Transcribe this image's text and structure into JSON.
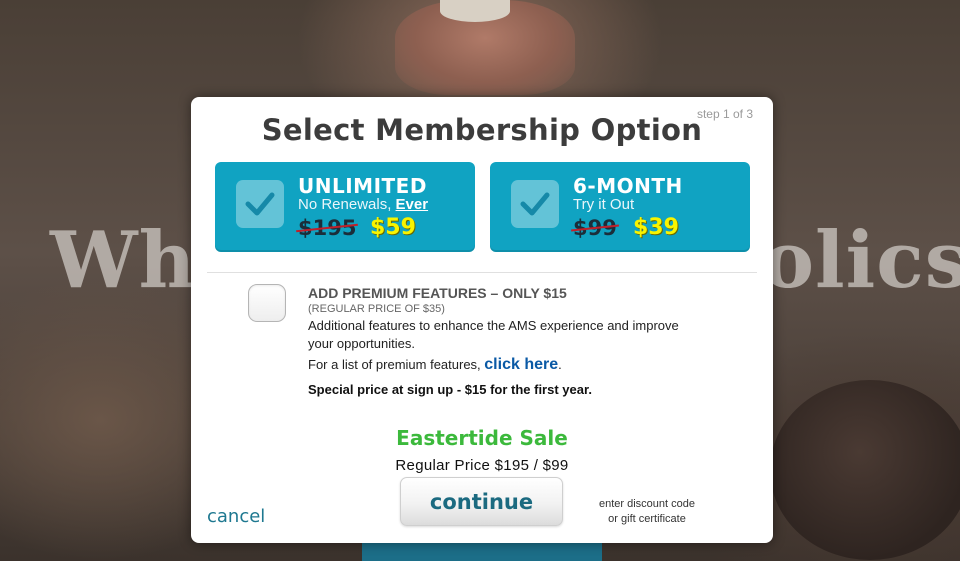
{
  "background": {
    "headline_left": "Whe",
    "headline_right": "olics"
  },
  "modal": {
    "step": "step 1 of 3",
    "title": "Select Membership Option",
    "options": [
      {
        "name": "UNLIMITED",
        "subtitle_prefix": "No Renewals, ",
        "subtitle_emphasis": "Ever",
        "old_price": "$195",
        "new_price": "$59",
        "selected": true
      },
      {
        "name": "6-MONTH",
        "subtitle_prefix": "Try it Out",
        "subtitle_emphasis": "",
        "old_price": "$99",
        "new_price": "$39",
        "selected": true
      }
    ],
    "premium": {
      "heading": "ADD PREMIUM FEATURES – ONLY $15",
      "regular": "(REGULAR PRICE OF $35)",
      "description": "Additional features to enhance the AMS experience and improve your opportunities.",
      "list_text": "For a list of premium features, ",
      "list_link": "click here",
      "list_suffix": ".",
      "special": "Special price at sign up - $15 for the first year.",
      "checked": false
    },
    "sale_title": "Eastertide Sale",
    "regular_price": "Regular Price  $195 / $99",
    "cancel_label": "cancel",
    "continue_label": "continue",
    "discount_line1": "enter discount code",
    "discount_line2": "or gift certificate"
  },
  "colors": {
    "option_bg": "#10a3c2",
    "new_price": "#f8f400",
    "sale_green": "#3cb93c",
    "link_blue": "#0a59a5",
    "strike_red": "#c0202a"
  },
  "icons": [
    "checkmark-icon"
  ]
}
